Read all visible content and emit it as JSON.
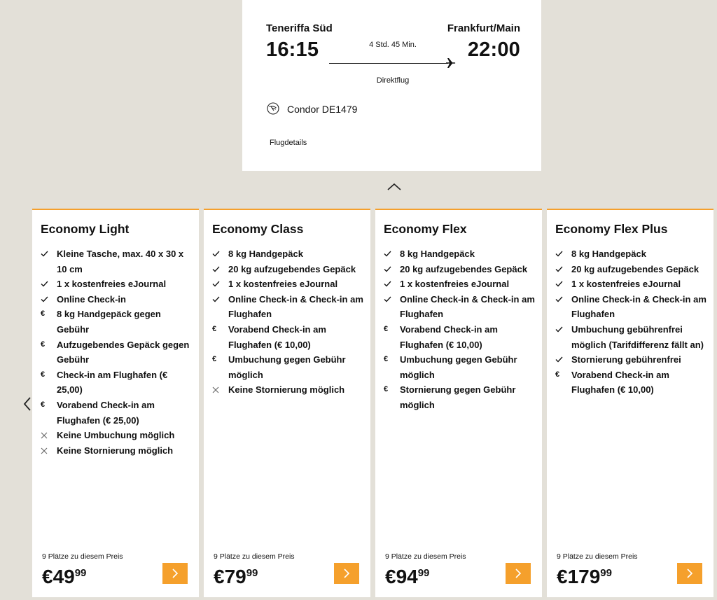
{
  "flight": {
    "origin": "Teneriffa Süd",
    "destination": "Frankfurt/Main",
    "departure_time": "16:15",
    "arrival_time": "22:00",
    "duration": "4 Std. 45 Min.",
    "flight_type": "Direktflug",
    "airline": "Condor DE1479",
    "details_link": "Flugdetails"
  },
  "icons": {
    "collapse": "chevron-up-icon",
    "previous": "chevron-left-icon",
    "airline": "condor-logo-icon",
    "plane": "plane-icon",
    "included": "check-icon",
    "fee": "euro-icon",
    "excluded": "cross-icon",
    "select": "chevron-right-icon"
  },
  "colors": {
    "accent": "#f5a02c",
    "background": "#e3e0d8"
  },
  "fares": [
    {
      "name": "Economy Light",
      "features": [
        {
          "type": "check",
          "text": "Kleine Tasche, max. 40 x 30 x 10 cm"
        },
        {
          "type": "check",
          "text": "1 x kostenfreies eJournal"
        },
        {
          "type": "check",
          "text": "Online Check-in"
        },
        {
          "type": "euro",
          "text": "8 kg Handgepäck gegen Gebühr"
        },
        {
          "type": "euro",
          "text": "Aufzugebendes Gepäck gegen Gebühr"
        },
        {
          "type": "euro",
          "text": "Check-in am Flughafen (€ 25,00)"
        },
        {
          "type": "euro",
          "text": "Vorabend Check-in am Flughafen (€ 25,00)"
        },
        {
          "type": "cross",
          "text": "Keine Umbuchung möglich"
        },
        {
          "type": "cross",
          "text": "Keine Stornierung möglich"
        }
      ],
      "seats": "9 Plätze zu diesem Preis",
      "price_main": "€49",
      "price_cents": "99"
    },
    {
      "name": "Economy Class",
      "features": [
        {
          "type": "check",
          "text": "8 kg Handgepäck"
        },
        {
          "type": "check",
          "text": "20 kg aufzugebendes Gepäck"
        },
        {
          "type": "check",
          "text": "1 x kostenfreies eJournal"
        },
        {
          "type": "check",
          "text": "Online Check-in & Check-in am Flughafen"
        },
        {
          "type": "euro",
          "text": "Vorabend Check-in am Flughafen (€ 10,00)"
        },
        {
          "type": "euro",
          "text": "Umbuchung gegen Gebühr möglich"
        },
        {
          "type": "cross",
          "text": "Keine Stornierung möglich"
        }
      ],
      "seats": "9 Plätze zu diesem Preis",
      "price_main": "€79",
      "price_cents": "99"
    },
    {
      "name": "Economy Flex",
      "features": [
        {
          "type": "check",
          "text": "8 kg Handgepäck"
        },
        {
          "type": "check",
          "text": "20 kg aufzugebendes Gepäck"
        },
        {
          "type": "check",
          "text": "1 x kostenfreies eJournal"
        },
        {
          "type": "check",
          "text": "Online Check-in & Check-in am Flughafen"
        },
        {
          "type": "euro",
          "text": "Vorabend Check-in am Flughafen (€ 10,00)"
        },
        {
          "type": "euro",
          "text": "Umbuchung gegen Gebühr möglich"
        },
        {
          "type": "euro",
          "text": "Stornierung gegen Gebühr möglich"
        }
      ],
      "seats": "9 Plätze zu diesem Preis",
      "price_main": "€94",
      "price_cents": "99"
    },
    {
      "name": "Economy Flex Plus",
      "features": [
        {
          "type": "check",
          "text": "8 kg Handgepäck"
        },
        {
          "type": "check",
          "text": "20 kg aufzugebendes Gepäck"
        },
        {
          "type": "check",
          "text": "1 x kostenfreies eJournal"
        },
        {
          "type": "check",
          "text": "Online Check-in & Check-in am Flughafen"
        },
        {
          "type": "check",
          "text": "Umbuchung gebührenfrei möglich (Tarifdifferenz fällt an)"
        },
        {
          "type": "check",
          "text": "Stornierung gebührenfrei"
        },
        {
          "type": "euro",
          "text": "Vorabend Check-in am Flughafen (€ 10,00)"
        }
      ],
      "seats": "9 Plätze zu diesem Preis",
      "price_main": "€179",
      "price_cents": "99"
    }
  ]
}
